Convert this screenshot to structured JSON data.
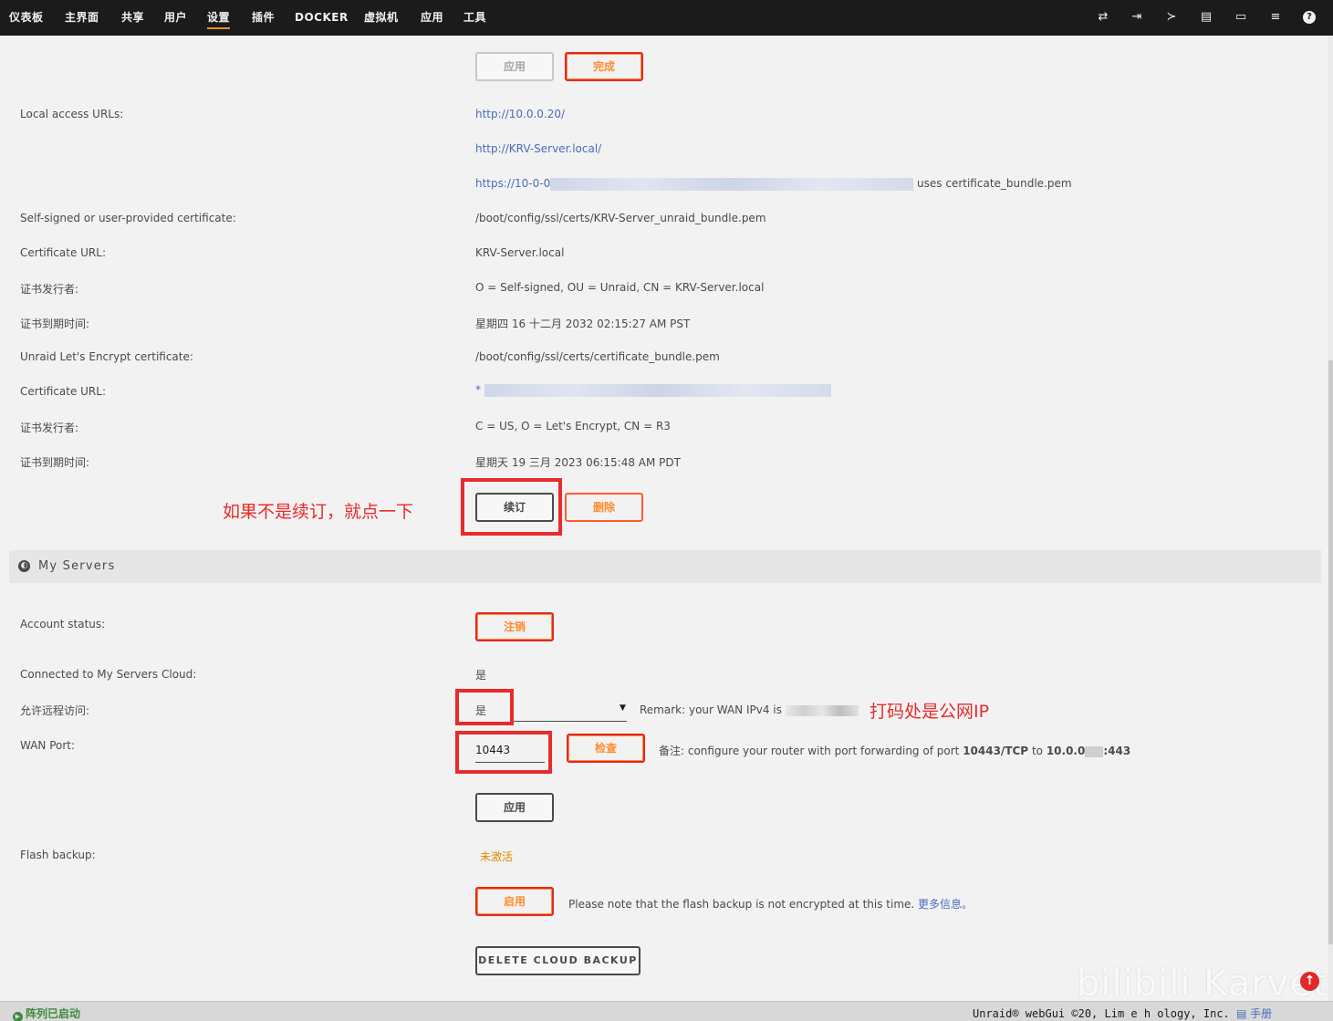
{
  "nav": {
    "items": [
      "仪表板",
      "主界面",
      "共享",
      "用户",
      "设置",
      "插件",
      "DOCKER",
      "虚拟机",
      "应用",
      "工具"
    ],
    "active": "设置",
    "icons": [
      "switch-icon",
      "logout-icon",
      "terminal-icon",
      "feedback-icon",
      "monitor-icon",
      "log-icon",
      "help-icon"
    ]
  },
  "top_buttons": {
    "apply": "应用",
    "done": "完成"
  },
  "local_urls": {
    "label": "Local access URLs:",
    "url1": "http://10.0.0.20/",
    "url2": "http://KRV-Server.local/",
    "url3_prefix": "https://10-0-0",
    "url3_suffix": "uses certificate_bundle.pem"
  },
  "self_signed": {
    "label": "Self-signed or user-provided certificate:",
    "value": "/boot/config/ssl/certs/KRV-Server_unraid_bundle.pem"
  },
  "cert_url_1": {
    "label": "Certificate URL:",
    "value": "KRV-Server.local"
  },
  "issuer_1": {
    "label": "证书发行者:",
    "value": "O = Self-signed, OU = Unraid, CN = KRV-Server.local"
  },
  "expiry_1": {
    "label": "证书到期时间:",
    "value": "星期四 16 十二月 2032 02:15:27 AM PST"
  },
  "le_cert": {
    "label": "Unraid Let's Encrypt certificate:",
    "value": "/boot/config/ssl/certs/certificate_bundle.pem"
  },
  "cert_url_2": {
    "label": "Certificate URL:",
    "value": "*"
  },
  "issuer_2": {
    "label": "证书发行者:",
    "value": "C = US, O = Let's Encrypt, CN = R3"
  },
  "expiry_2": {
    "label": "证书到期时间:",
    "value": "星期天 19 三月 2023 06:15:48 AM PDT"
  },
  "cert_buttons": {
    "renew": "续订",
    "delete": "删除"
  },
  "annotation_renew": "如果不是续订，就点一下",
  "section": {
    "title": "My Servers"
  },
  "account": {
    "label": "Account status:",
    "button": "注销"
  },
  "connected": {
    "label": "Connected to My Servers Cloud:",
    "value": "是"
  },
  "remote": {
    "label": "允许远程访问:",
    "value": "是",
    "remark_prefix": "Remark: your WAN IPv4 is",
    "annotation": "打码处是公网IP"
  },
  "wan": {
    "label": "WAN Port:",
    "value": "10443",
    "check": "检查",
    "note_prefix": "备注: configure your router with port forwarding of port",
    "note_port": "10443/TCP",
    "note_to": "to",
    "note_ip": "10.0.0",
    "note_port2": ":443"
  },
  "wan_apply": "应用",
  "flash": {
    "label": "Flash backup:",
    "status": "未激活",
    "enable": "启用",
    "note": "Please note that the flash backup is not encrypted at this time.",
    "more": "更多信息。",
    "delete": "DELETE CLOUD BACKUP"
  },
  "footer": {
    "status": "阵列已启动",
    "copyright": "Unraid® webGui ©20",
    "copyright_tail": ", Lim  e h ology, Inc.",
    "manual": "手册"
  },
  "watermark": "bilibili Karvet",
  "colors": {
    "accent": "#ff8c2f",
    "annotation_red": "#e82b2b",
    "link": "#486dba",
    "topbar": "#1c1b1b"
  }
}
